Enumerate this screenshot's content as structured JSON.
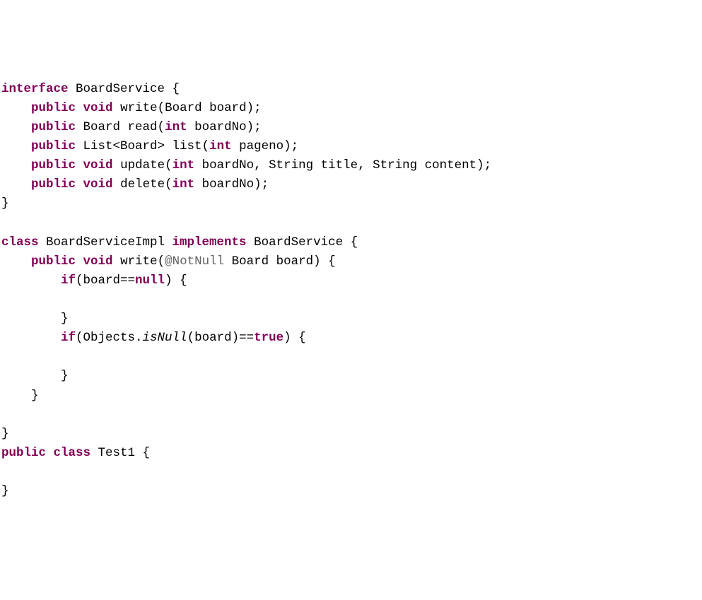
{
  "tokens": [
    {
      "t": "interface",
      "c": "kw"
    },
    {
      "t": " BoardService {",
      "c": "plain"
    },
    {
      "br": true
    },
    {
      "t": "    ",
      "c": "plain"
    },
    {
      "t": "public",
      "c": "kw"
    },
    {
      "t": " ",
      "c": "plain"
    },
    {
      "t": "void",
      "c": "kw"
    },
    {
      "t": " write(Board board);",
      "c": "plain"
    },
    {
      "br": true
    },
    {
      "t": "    ",
      "c": "plain"
    },
    {
      "t": "public",
      "c": "kw"
    },
    {
      "t": " Board read(",
      "c": "plain"
    },
    {
      "t": "int",
      "c": "kw"
    },
    {
      "t": " boardNo);",
      "c": "plain"
    },
    {
      "br": true
    },
    {
      "t": "    ",
      "c": "plain"
    },
    {
      "t": "public",
      "c": "kw"
    },
    {
      "t": " List<Board> list(",
      "c": "plain"
    },
    {
      "t": "int",
      "c": "kw"
    },
    {
      "t": " pageno);",
      "c": "plain"
    },
    {
      "br": true
    },
    {
      "t": "    ",
      "c": "plain"
    },
    {
      "t": "public",
      "c": "kw"
    },
    {
      "t": " ",
      "c": "plain"
    },
    {
      "t": "void",
      "c": "kw"
    },
    {
      "t": " update(",
      "c": "plain"
    },
    {
      "t": "int",
      "c": "kw"
    },
    {
      "t": " boardNo, String title, String content);",
      "c": "plain"
    },
    {
      "br": true
    },
    {
      "t": "    ",
      "c": "plain"
    },
    {
      "t": "public",
      "c": "kw"
    },
    {
      "t": " ",
      "c": "plain"
    },
    {
      "t": "void",
      "c": "kw"
    },
    {
      "t": " delete(",
      "c": "plain"
    },
    {
      "t": "int",
      "c": "kw"
    },
    {
      "t": " boardNo);",
      "c": "plain"
    },
    {
      "br": true
    },
    {
      "t": "}",
      "c": "plain"
    },
    {
      "br": true
    },
    {
      "br": true
    },
    {
      "t": "class",
      "c": "kw"
    },
    {
      "t": " BoardServiceImpl ",
      "c": "plain"
    },
    {
      "t": "implements",
      "c": "kw"
    },
    {
      "t": " BoardService {",
      "c": "plain"
    },
    {
      "br": true
    },
    {
      "t": "    ",
      "c": "plain"
    },
    {
      "t": "public",
      "c": "kw"
    },
    {
      "t": " ",
      "c": "plain"
    },
    {
      "t": "void",
      "c": "kw"
    },
    {
      "t": " write(",
      "c": "plain"
    },
    {
      "t": "@NotNull",
      "c": "ann"
    },
    {
      "t": " Board board) {",
      "c": "plain"
    },
    {
      "br": true
    },
    {
      "t": "        ",
      "c": "plain"
    },
    {
      "t": "if",
      "c": "kw"
    },
    {
      "t": "(board==",
      "c": "plain"
    },
    {
      "t": "null",
      "c": "kw"
    },
    {
      "t": ") {",
      "c": "plain"
    },
    {
      "br": true
    },
    {
      "br": true
    },
    {
      "t": "        }",
      "c": "plain"
    },
    {
      "br": true
    },
    {
      "t": "        ",
      "c": "plain"
    },
    {
      "t": "if",
      "c": "kw"
    },
    {
      "t": "(Objects.",
      "c": "plain"
    },
    {
      "t": "isNull",
      "c": "plain",
      "i": true
    },
    {
      "t": "(board)==",
      "c": "plain"
    },
    {
      "t": "true",
      "c": "kw"
    },
    {
      "t": ") {",
      "c": "plain"
    },
    {
      "br": true
    },
    {
      "br": true
    },
    {
      "t": "        }",
      "c": "plain"
    },
    {
      "br": true
    },
    {
      "t": "    }",
      "c": "plain"
    },
    {
      "br": true
    },
    {
      "br": true
    },
    {
      "t": "}",
      "c": "plain"
    },
    {
      "br": true
    },
    {
      "t": "public",
      "c": "kw"
    },
    {
      "t": " ",
      "c": "plain"
    },
    {
      "t": "class",
      "c": "kw"
    },
    {
      "t": " Test1 {",
      "c": "plain"
    },
    {
      "br": true
    },
    {
      "br": true
    },
    {
      "t": "}",
      "c": "plain"
    }
  ]
}
